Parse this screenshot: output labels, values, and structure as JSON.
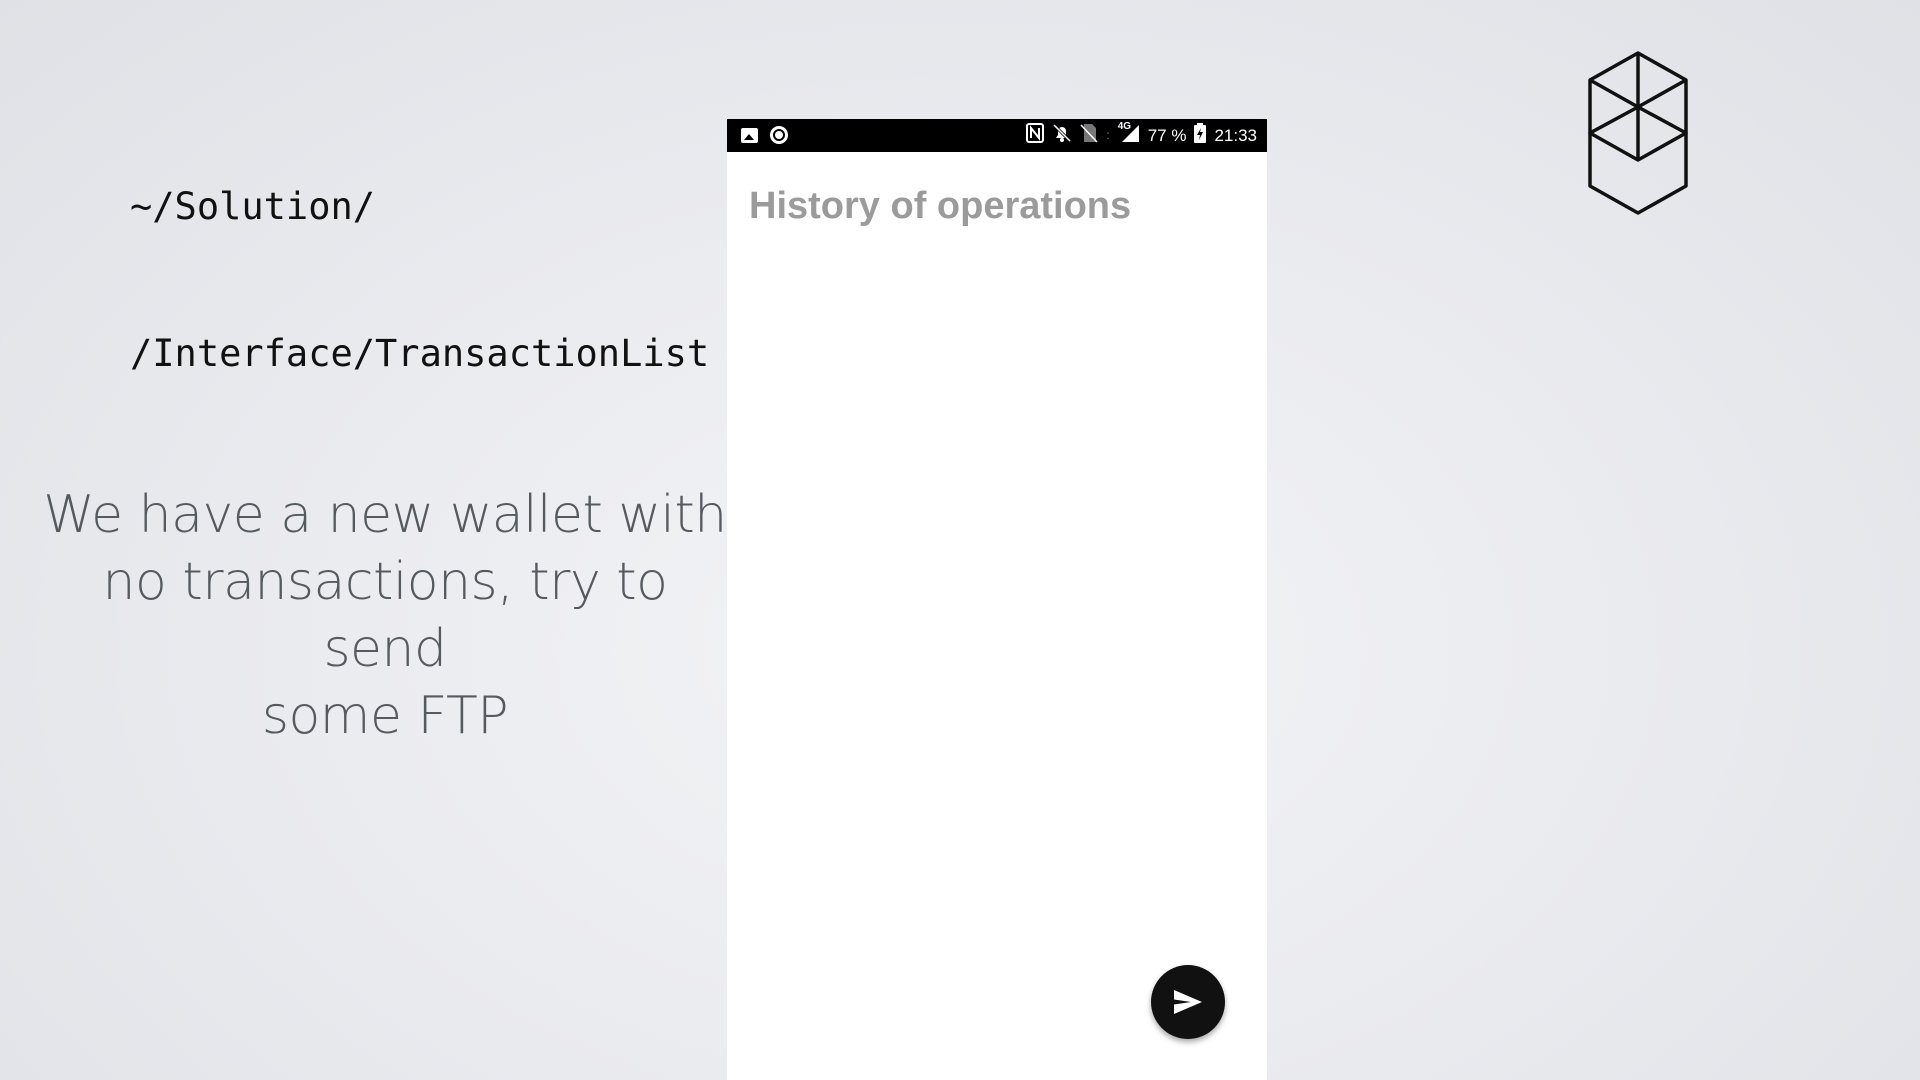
{
  "slide": {
    "path_line1": "~/Solution/",
    "path_line2": "/Interface/TransactionList",
    "caption_line1": "We have a new wallet with",
    "caption_line2": "no transactions, try to send",
    "caption_line3": "some FTP"
  },
  "phone": {
    "status_bar": {
      "left_icons": [
        "gallery-icon",
        "circle-icon"
      ],
      "right_icons": [
        "nfc-icon",
        "bell-off-icon",
        "sim-off-icon",
        "signal-4g-icon",
        "battery-icon"
      ],
      "network_label": "4G",
      "battery": "77 %",
      "time": "21:33"
    },
    "screen_title": "History of operations",
    "fab_icon": "send-icon"
  },
  "logo_icon": "hexagon-cube-logo-icon",
  "colors": {
    "background": "#e9eaee",
    "title_gray": "#9b9b9b",
    "caption_gray": "#555a5f",
    "fab": "#111111"
  }
}
